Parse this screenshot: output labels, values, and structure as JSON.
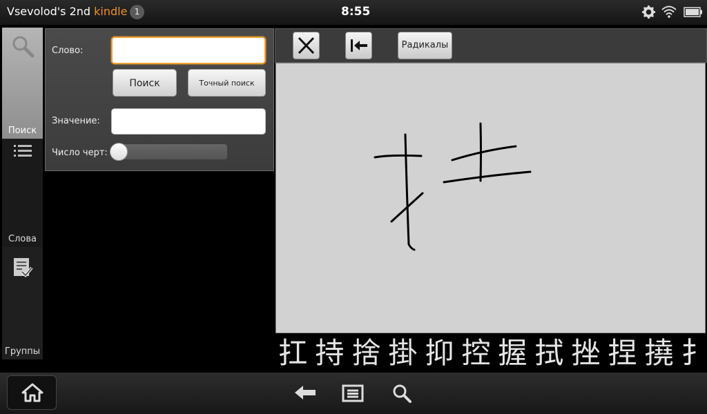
{
  "status": {
    "device_name_prefix": "Vsevolod's 2nd ",
    "device_name_brand": "kindle",
    "notification_count": "1",
    "clock": "8:55"
  },
  "nav": {
    "tabs": [
      {
        "label": "Поиск",
        "icon": "magnifier-icon",
        "active": true
      },
      {
        "label": "Слова",
        "icon": "list-icon",
        "active": false
      },
      {
        "label": "Группы",
        "icon": "checklist-icon",
        "active": false
      }
    ]
  },
  "search": {
    "word_label": "Слово:",
    "word_value": "",
    "search_button": "Поиск",
    "exact_search_button": "Точный поиск",
    "meaning_label": "Значение:",
    "meaning_value": "",
    "strokes_label": "Число черт:",
    "strokes_value": 0
  },
  "toolbar": {
    "clear_icon": "close-icon",
    "backspace_icon": "backspace-icon",
    "radicals_button": "Радикалы"
  },
  "candidates": [
    "扛",
    "持",
    "捨",
    "掛",
    "抑",
    "控",
    "握",
    "拭",
    "挫",
    "捏",
    "撓",
    "扌"
  ],
  "colors": {
    "accent": "#f0902a",
    "canvas_bg": "#d2d2d2"
  }
}
